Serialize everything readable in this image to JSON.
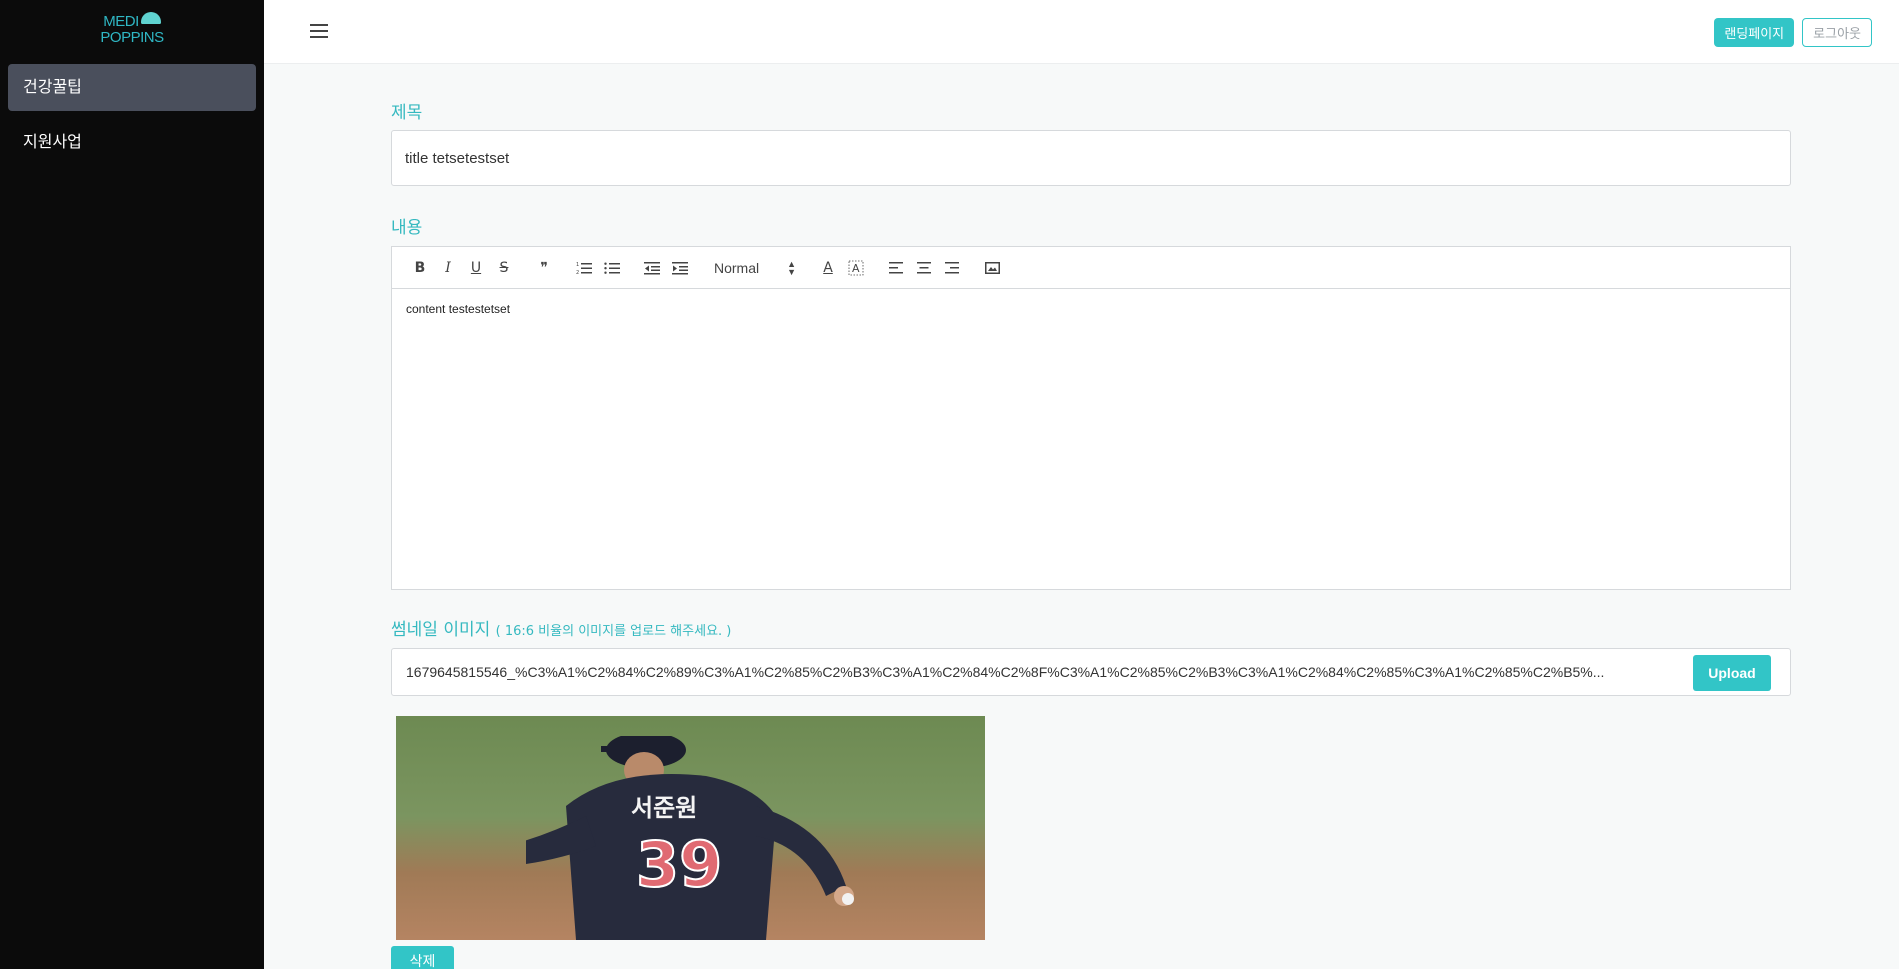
{
  "brand": {
    "line1": "MEDI",
    "line2": "POPPINS"
  },
  "sidebar": {
    "items": [
      {
        "label": "건강꿀팁",
        "active": true
      },
      {
        "label": "지원사업",
        "active": false
      }
    ]
  },
  "header": {
    "landing_label": "랜딩페이지",
    "logout_label": "로그아웃"
  },
  "form": {
    "title_label": "제목",
    "title_value": "title tetsetestset",
    "content_label": "내용",
    "editor": {
      "heading_select": "Normal",
      "body_text": "content testestetset"
    },
    "thumbnail_label": "썸네일 이미지",
    "thumbnail_hint": "( 16:6 비율의 이미지를 업로드 해주세요. )",
    "file_name": "1679645815546_%C3%A1%C2%84%C2%89%C3%A1%C2%85%C2%B3%C3%A1%C2%84%C2%8F%C3%A1%C2%85%C2%B3%C3%A1%C2%84%C2%85%C3%A1%C2%85%C2%B5%...",
    "upload_label": "Upload",
    "jersey_name": "서준원",
    "jersey_number": "39",
    "delete_label": "삭제"
  },
  "colors": {
    "accent": "#32c5c7",
    "label": "#35b9c0",
    "sidebar_bg": "#0b0b0b",
    "sidebar_active": "#4a4f5c"
  }
}
